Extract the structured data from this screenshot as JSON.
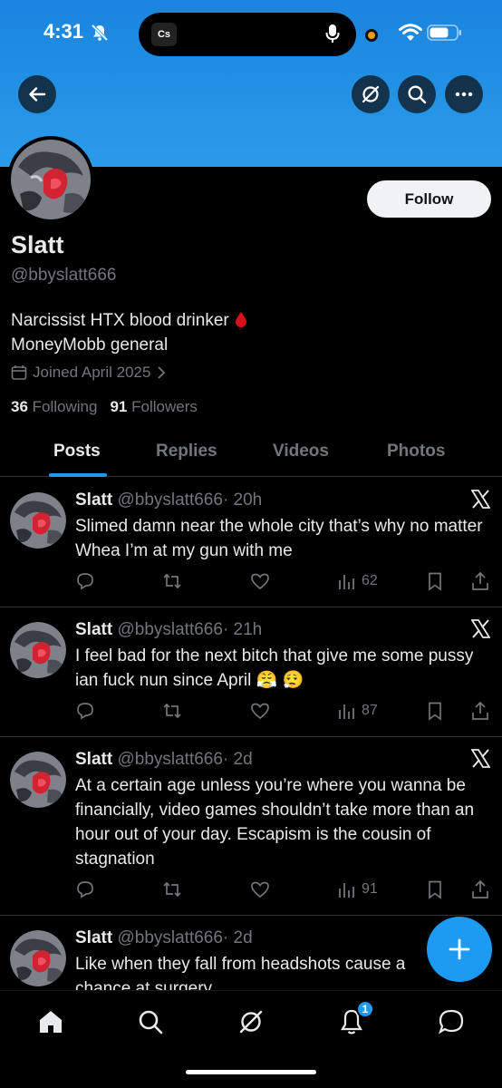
{
  "status_bar": {
    "time": "4:31",
    "island_app_label": "Cs"
  },
  "profile": {
    "display_name": "Slatt",
    "handle": "@bbyslatt666",
    "bio_line1": "Narcissist HTX blood drinker",
    "bio_line2": "MoneyMobb general",
    "joined": "Joined April 2025",
    "following_count": "36",
    "following_label": "Following",
    "followers_count": "91",
    "followers_label": "Followers",
    "follow_button": "Follow"
  },
  "tabs": [
    {
      "label": "Posts",
      "active": true
    },
    {
      "label": "Replies",
      "active": false
    },
    {
      "label": "Videos",
      "active": false
    },
    {
      "label": "Photos",
      "active": false
    }
  ],
  "posts": [
    {
      "name": "Slatt",
      "handle": "@bbyslatt666",
      "time": "· 20h",
      "text": "Slimed damn near the whole city that’s why no matter Whea I’m at my gun with me",
      "views": "62"
    },
    {
      "name": "Slatt",
      "handle": "@bbyslatt666",
      "time": "· 21h",
      "text": "I feel bad for the next bitch that give me some pussy ian fuck nun since April 😤 😮‍💨",
      "views": "87"
    },
    {
      "name": "Slatt",
      "handle": "@bbyslatt666",
      "time": "· 2d",
      "text": "At a certain age unless you’re where you wanna be financially, video games shouldn’t take more than an hour out of your day. Escapism is the cousin of stagnation",
      "views": "91"
    },
    {
      "name": "Slatt",
      "handle": "@bbyslatt666",
      "time": "· 2d",
      "text": "Like when they fall from headshots cause a chance at surgery",
      "views": ""
    }
  ],
  "nav": {
    "notification_badge": "1"
  },
  "colors": {
    "accent": "#1d9bf0",
    "banner": "#2a9ce8",
    "muted": "#71767b"
  },
  "icons": [
    "back-arrow-icon",
    "grok-icon",
    "search-icon",
    "more-icon",
    "calendar-icon",
    "chevron-right-icon",
    "reply-icon",
    "repost-icon",
    "like-icon",
    "views-icon",
    "bookmark-icon",
    "share-icon",
    "x-logo-icon",
    "home-icon",
    "bell-icon",
    "messages-icon",
    "compose-plus-icon"
  ]
}
